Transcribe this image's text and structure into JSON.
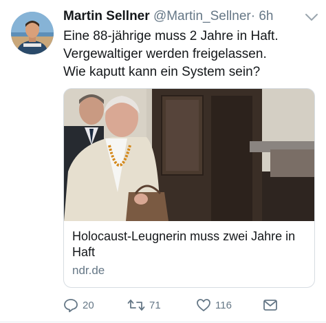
{
  "tweet": {
    "author_name": "Martin Sellner",
    "author_handle": "@Martin_Sellner",
    "separator": "·",
    "timestamp": "6h",
    "text_lines": [
      "Eine 88-jährige muss 2 Jahre in Haft.",
      "Vergewaltiger werden freigelassen.",
      "Wie kaputt kann ein System sein?"
    ]
  },
  "card": {
    "title": "Holocaust-Leugnerin muss zwei Jahre in Haft",
    "domain": "ndr.de",
    "image_icon": "news-photo-woman-with-man-in-corridor"
  },
  "actions": {
    "reply_count": "20",
    "retweet_count": "71",
    "like_count": "116"
  },
  "icons": {
    "menu": "chevron-down-icon",
    "reply": "reply-icon",
    "retweet": "retweet-icon",
    "like": "heart-icon",
    "message": "envelope-icon"
  },
  "colors": {
    "text": "#14171a",
    "secondary": "#657786",
    "border": "#d6dce1"
  }
}
